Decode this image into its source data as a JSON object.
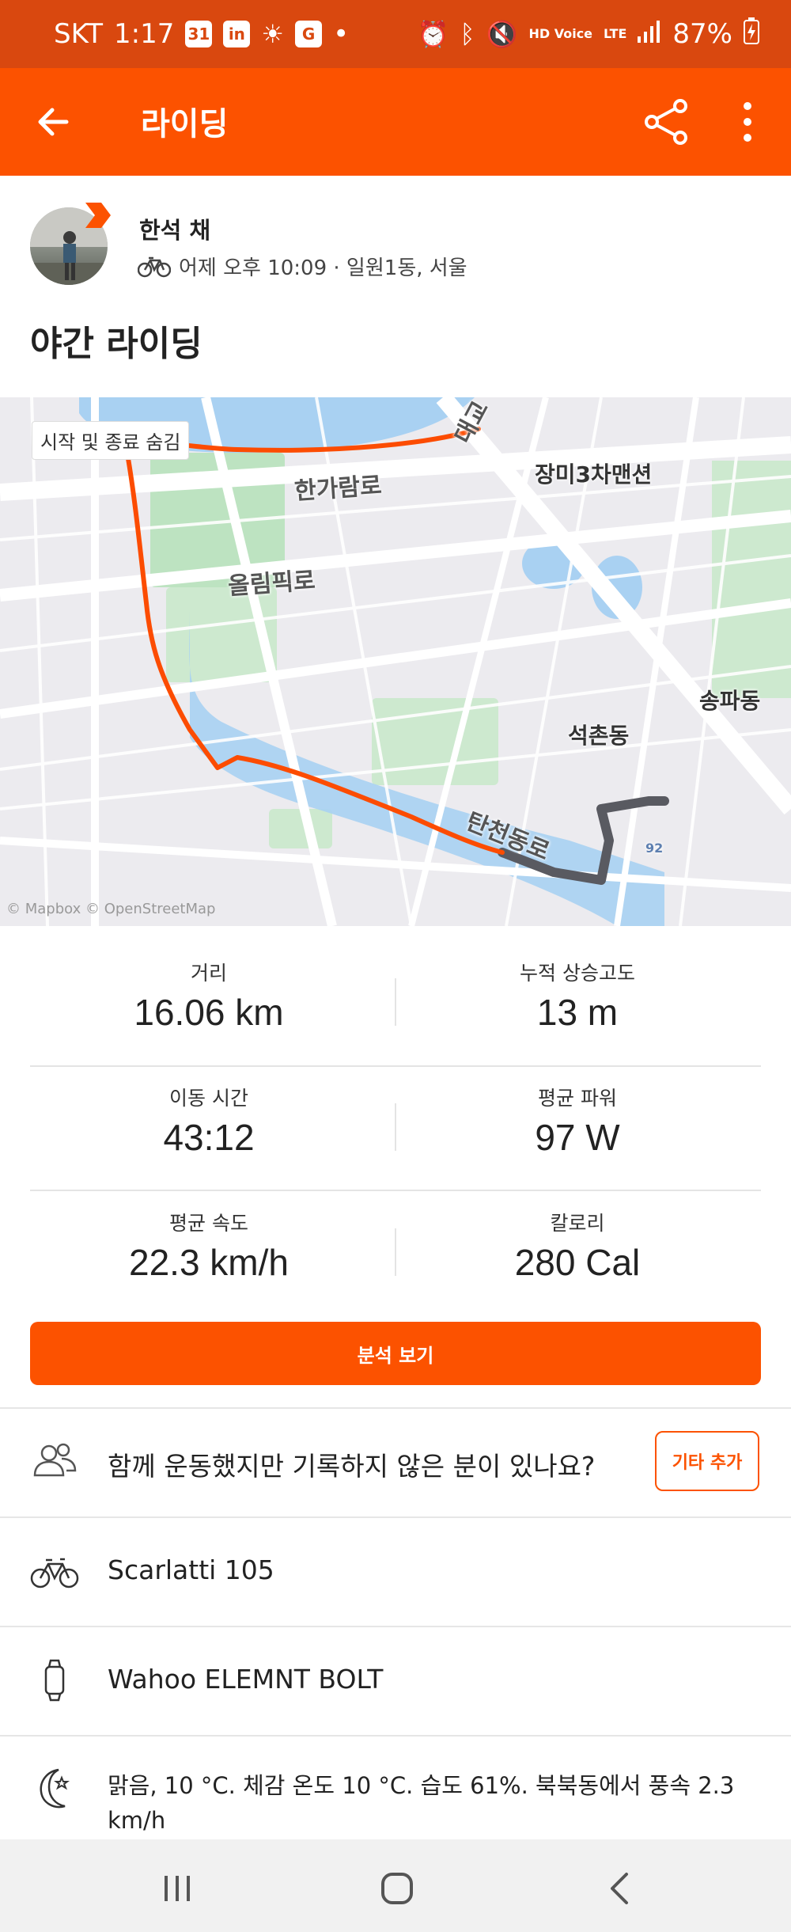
{
  "status_bar": {
    "carrier": "SKT",
    "time": "1:17",
    "calendar_badge": "31",
    "battery": "87%",
    "network": "LTE",
    "hd_voice": "HD Voice"
  },
  "app_bar": {
    "title": "라이딩"
  },
  "athlete": {
    "name": "한석 채",
    "meta": "어제 오후 10:09 · 일원1동, 서울"
  },
  "activity": {
    "title": "야간 라이딩"
  },
  "map": {
    "toggle_label": "시작 및 종료 숨김",
    "labels": {
      "hangaram": "한가람로",
      "olympic": "올림픽로",
      "jangmi": "장미3차맨션",
      "songpa": "송파동",
      "seokchon": "석촌동",
      "tancheon": "탄천동로",
      "bridge": "대교",
      "road92": "92"
    },
    "attribution": "© Mapbox © OpenStreetMap",
    "route_color": "#fc4c02",
    "hidden_route_color": "#595a61"
  },
  "stats": [
    {
      "label": "거리",
      "value": "16.06 km"
    },
    {
      "label": "누적 상승고도",
      "value": "13 m"
    },
    {
      "label": "이동 시간",
      "value": "43:12"
    },
    {
      "label": "평균 파워",
      "value": "97 W"
    },
    {
      "label": "평균 속도",
      "value": "22.3 km/h"
    },
    {
      "label": "칼로리",
      "value": "280 Cal"
    }
  ],
  "actions": {
    "analysis_button": "분석 보기",
    "group_prompt": "함께 운동했지만 기록하지 않은 분이 있나요?",
    "add_other_button": "기타 추가"
  },
  "gear": {
    "bike": "Scarlatti 105",
    "device": "Wahoo ELEMNT BOLT"
  },
  "weather": {
    "text": "맑음, 10 °C. 체감 온도 10 °C. 습도 61%. 북북동에서 풍속 2.3 km/h"
  },
  "colors": {
    "brand": "#fc5200",
    "status_bar": "#d9480f"
  }
}
